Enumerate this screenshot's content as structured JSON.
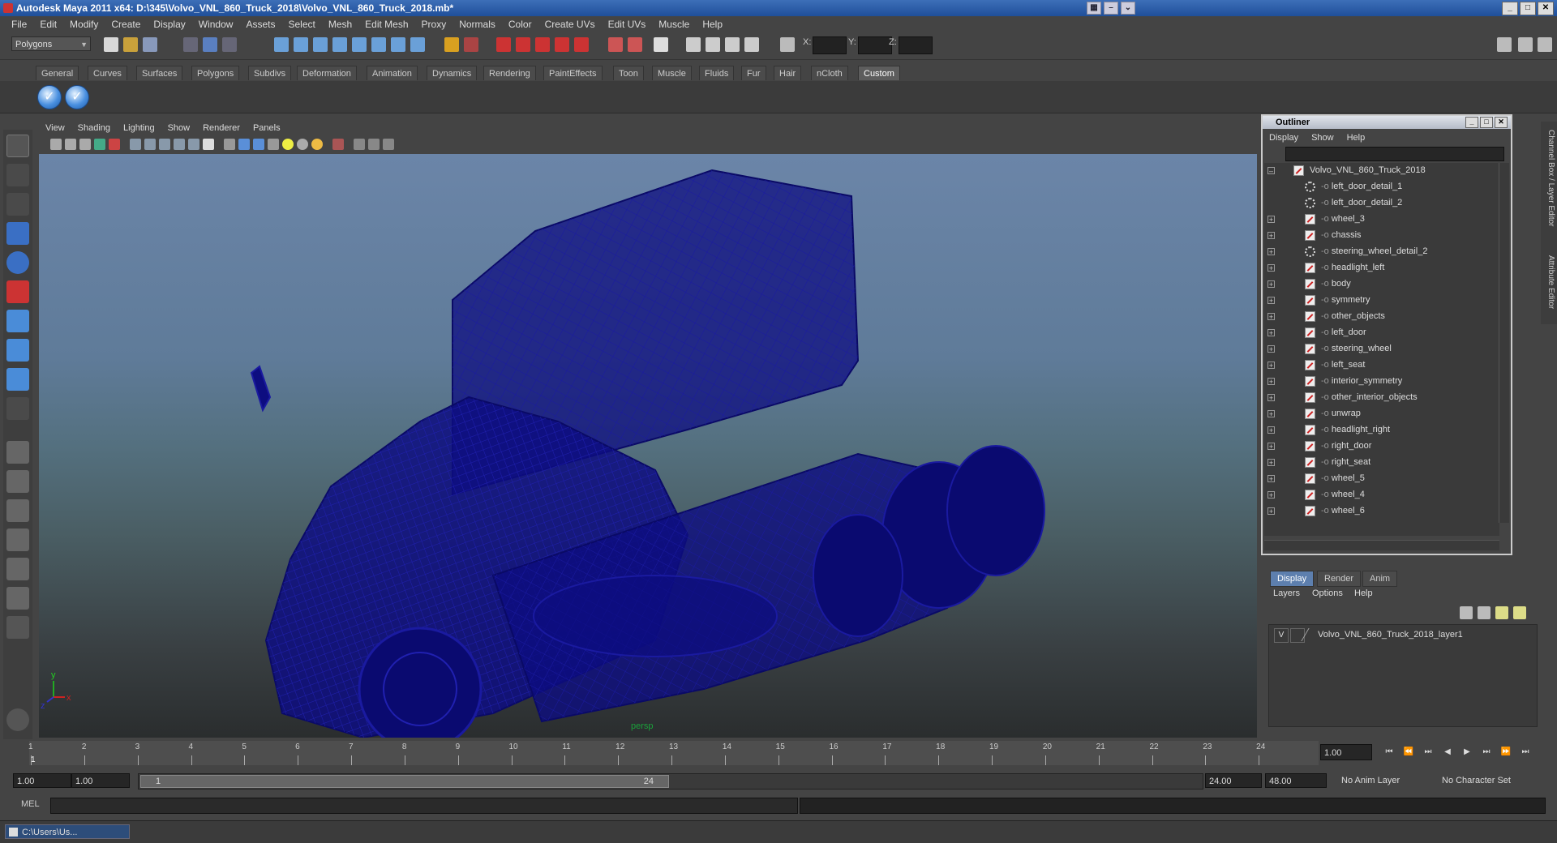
{
  "window": {
    "title": "Autodesk Maya 2011 x64: D:\\345\\Volvo_VNL_860_Truck_2018\\Volvo_VNL_860_Truck_2018.mb*",
    "controls": [
      "_",
      "□",
      "✕"
    ]
  },
  "menubar": [
    "File",
    "Edit",
    "Modify",
    "Create",
    "Display",
    "Window",
    "Assets",
    "Select",
    "Mesh",
    "Edit Mesh",
    "Proxy",
    "Normals",
    "Color",
    "Create UVs",
    "Edit UVs",
    "Muscle",
    "Help"
  ],
  "statusline": {
    "mode": "Polygons",
    "xyz_labels": [
      "X:",
      "Y:",
      "Z:"
    ]
  },
  "shelf": {
    "tabs": [
      "General",
      "Curves",
      "Surfaces",
      "Polygons",
      "Subdivs",
      "Deformation",
      "Animation",
      "Dynamics",
      "Rendering",
      "PaintEffects",
      "Toon",
      "Muscle",
      "Fluids",
      "Fur",
      "Hair",
      "nCloth",
      "Custom"
    ],
    "active_tab": "Custom"
  },
  "viewport": {
    "menu": [
      "View",
      "Shading",
      "Lighting",
      "Show",
      "Renderer",
      "Panels"
    ],
    "camera_label": "persp",
    "axis_x": "x",
    "axis_y": "y",
    "axis_z": "z",
    "wire_color": "#0d0d80"
  },
  "outliner": {
    "title": "Outliner",
    "menu": [
      "Display",
      "Show",
      "Help"
    ],
    "root": "Volvo_VNL_860_Truck_2018",
    "items": [
      {
        "label": "left_door_detail_1",
        "kind": "group",
        "expandable": false
      },
      {
        "label": "left_door_detail_2",
        "kind": "group",
        "expandable": false
      },
      {
        "label": "wheel_3",
        "kind": "mesh",
        "expandable": true
      },
      {
        "label": "chassis",
        "kind": "mesh",
        "expandable": true
      },
      {
        "label": "steering_wheel_detail_2",
        "kind": "group",
        "expandable": true
      },
      {
        "label": "headlight_left",
        "kind": "mesh",
        "expandable": true
      },
      {
        "label": "body",
        "kind": "mesh",
        "expandable": true
      },
      {
        "label": "symmetry",
        "kind": "mesh",
        "expandable": true
      },
      {
        "label": "other_objects",
        "kind": "mesh",
        "expandable": true
      },
      {
        "label": "left_door",
        "kind": "mesh",
        "expandable": true
      },
      {
        "label": "steering_wheel",
        "kind": "mesh",
        "expandable": true
      },
      {
        "label": "left_seat",
        "kind": "mesh",
        "expandable": true
      },
      {
        "label": "interior_symmetry",
        "kind": "mesh",
        "expandable": true
      },
      {
        "label": "other_interior_objects",
        "kind": "mesh",
        "expandable": true
      },
      {
        "label": "unwrap",
        "kind": "mesh",
        "expandable": true
      },
      {
        "label": "headlight_right",
        "kind": "mesh",
        "expandable": true
      },
      {
        "label": "right_door",
        "kind": "mesh",
        "expandable": true
      },
      {
        "label": "right_seat",
        "kind": "mesh",
        "expandable": true
      },
      {
        "label": "wheel_5",
        "kind": "mesh",
        "expandable": true
      },
      {
        "label": "wheel_4",
        "kind": "mesh",
        "expandable": true
      },
      {
        "label": "wheel_6",
        "kind": "mesh",
        "expandable": true
      }
    ]
  },
  "sidetabs": [
    "Channel Box / Layer Editor",
    "Attribute Editor"
  ],
  "layer_editor": {
    "tabs": [
      "Display",
      "Render",
      "Anim"
    ],
    "active_tab": "Display",
    "menu": [
      "Layers",
      "Options",
      "Help"
    ],
    "layer": {
      "visible": "V",
      "name": "Volvo_VNL_860_Truck_2018_layer1"
    }
  },
  "timeline": {
    "frames": [
      "1",
      "2",
      "3",
      "4",
      "5",
      "6",
      "7",
      "8",
      "9",
      "10",
      "11",
      "12",
      "13",
      "14",
      "15",
      "16",
      "17",
      "18",
      "19",
      "20",
      "21",
      "22",
      "23",
      "24"
    ],
    "current_frame_marker": "1",
    "current_time": "1.00"
  },
  "range": {
    "start": "1.00",
    "playback_start": "1.00",
    "handle_start": "1",
    "handle_end": "24",
    "playback_end": "24.00",
    "end": "48.00",
    "anim_layer": "No Anim Layer",
    "character_set": "No Character Set"
  },
  "cmdline": {
    "label": "MEL"
  },
  "taskbar": {
    "item": "C:\\Users\\Us..."
  }
}
